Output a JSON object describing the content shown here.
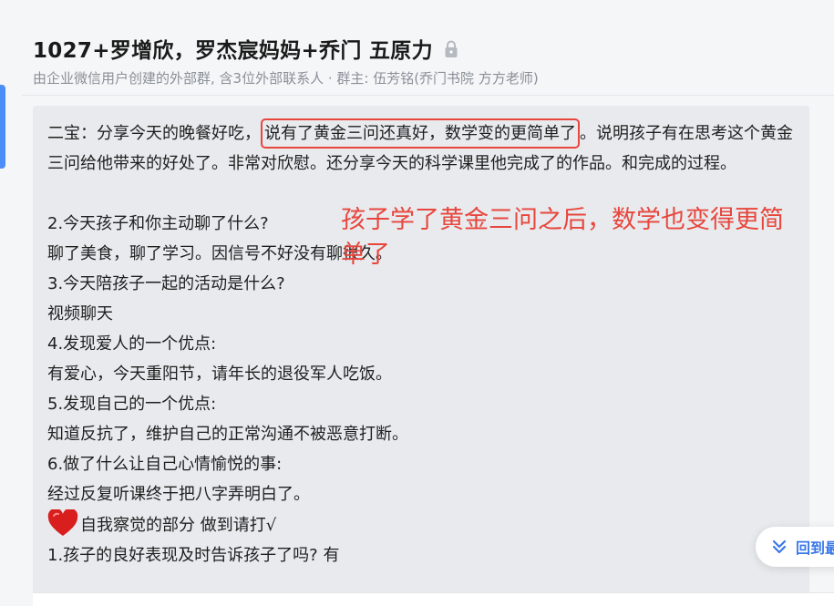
{
  "chat": {
    "title": "1027+罗增欣，罗杰宸妈妈+乔门 五原力",
    "subtitle": "由企业微信用户创建的外部群, 含3位外部联系人 · 群主: 伍芳铭(乔门书院 方方老师)",
    "lock_icon": "lock-icon"
  },
  "message": {
    "line1_prefix": "二宝：分享今天的晚餐好吃，",
    "line1_highlight": "说有了黄金三问还真好，数学变的更简单了",
    "line1_suffix": "。说明孩子有在思考这个黄金三问给他带来的好处了。非常对欣慰。还分享今天的科学课里他完成了的作品。和完成的过程。",
    "q2": "2.今天孩子和你主动聊了什么?",
    "a2": "聊了美食，聊了学习。因信号不好没有聊很久。",
    "q3": "3.今天陪孩子一起的活动是什么?",
    "a3": "视频聊天",
    "q4": "4.发现爱人的一个优点:",
    "a4": "有爱心，今天重阳节，请年长的退役军人吃饭。",
    "q5": "5.发现自己的一个优点:",
    "a5": "知道反抗了，维护自己的正常沟通不被恶意打断。",
    "q6": "6.做了什么让自己心情愉悦的事:",
    "a6": "经过反复听课终于把八字弄明白了。",
    "self_check": "自我察觉的部分 做到请打√",
    "item1": "1.孩子的良好表现及时告诉孩子了吗? 有",
    "heart_icon": "red-heart-icon"
  },
  "annotation": {
    "text": "孩子学了黄金三问之后，数学也变得更简单了",
    "color": "#e8463d"
  },
  "back_button": {
    "label": "回到最",
    "icon": "double-chevron-down-icon"
  },
  "colors": {
    "accent": "#4c8ef7",
    "highlight_border": "#e8463d",
    "bubble_bg": "#e8eaed",
    "link_blue": "#3a78e8"
  }
}
